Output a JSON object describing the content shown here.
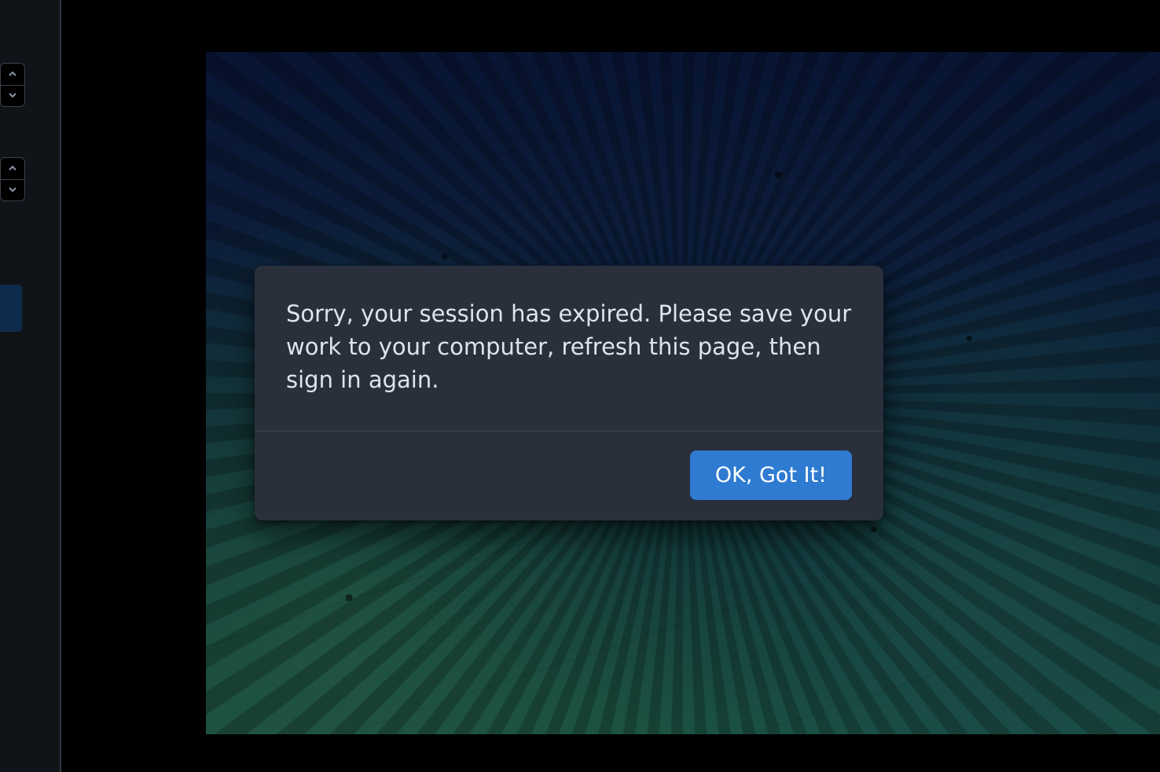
{
  "colors": {
    "accent": "#2f7bd1",
    "panel": "#2a2f3c",
    "panel_border": "#3d4352",
    "body_text": "#dfe4ec",
    "rail_bg": "#101418",
    "accent_tab": "#0d2b4a"
  },
  "rail": {
    "spinner1": {
      "up_label": "increment",
      "down_label": "decrement"
    },
    "spinner2": {
      "up_label": "increment",
      "down_label": "decrement"
    }
  },
  "modal": {
    "message": "Sorry, your session has expired. Please save your work to your computer, refresh this page, then sign in again.",
    "ok_label": "OK, Got It!"
  }
}
